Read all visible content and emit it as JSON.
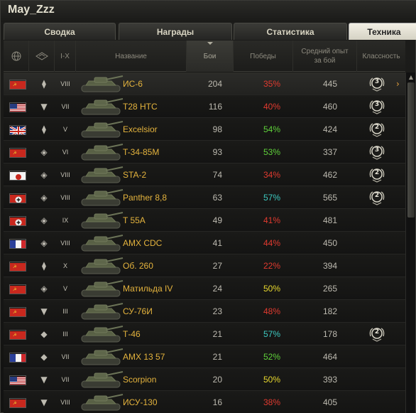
{
  "window": {
    "title": "May_Zzz"
  },
  "tabs": [
    {
      "label": "Сводка"
    },
    {
      "label": "Награды"
    },
    {
      "label": "Статистика"
    },
    {
      "label": "Техника"
    }
  ],
  "columns": {
    "nation_icon": "globe-icon",
    "type_icon": "vehicle-type-icon",
    "tier": "I-X",
    "name": "Название",
    "battles": "Бои",
    "wins": "Победы",
    "avg_xp": "Средний опыт за бой",
    "mastery": "Классность"
  },
  "colors": {
    "accent_gold": "#e4b33d",
    "win_red": "#e03a2f",
    "win_yellow": "#e8d82e",
    "win_green": "#5fd13a",
    "win_teal": "#3dc9c0"
  },
  "vehicles": [
    {
      "nation": "ussr",
      "type": "heavy",
      "tier": "VIII",
      "name": "ИС-6",
      "battles": "204",
      "wins": "35%",
      "win_color": "red",
      "avg_xp": "445",
      "mastery": "3",
      "selected": true
    },
    {
      "nation": "usa",
      "type": "td",
      "tier": "VII",
      "name": "T28 HTC",
      "battles": "116",
      "wins": "40%",
      "win_color": "red",
      "avg_xp": "460",
      "mastery": "3"
    },
    {
      "nation": "uk",
      "type": "heavy",
      "tier": "V",
      "name": "Excelsior",
      "battles": "98",
      "wins": "54%",
      "win_color": "green",
      "avg_xp": "424",
      "mastery": "2"
    },
    {
      "nation": "ussr",
      "type": "medium",
      "tier": "VI",
      "name": "T-34-85M",
      "battles": "93",
      "wins": "53%",
      "win_color": "green",
      "avg_xp": "337",
      "mastery": "3"
    },
    {
      "nation": "japan",
      "type": "medium",
      "tier": "VIII",
      "name": "STA-2",
      "battles": "74",
      "wins": "34%",
      "win_color": "red",
      "avg_xp": "462",
      "mastery": "2"
    },
    {
      "nation": "germany",
      "type": "medium",
      "tier": "VIII",
      "name": "Panther 8,8",
      "battles": "63",
      "wins": "57%",
      "win_color": "teal",
      "avg_xp": "565",
      "mastery": "2"
    },
    {
      "nation": "germany",
      "type": "medium",
      "tier": "IX",
      "name": "T 55A",
      "battles": "49",
      "wins": "41%",
      "win_color": "red",
      "avg_xp": "481",
      "mastery": ""
    },
    {
      "nation": "france",
      "type": "medium",
      "tier": "VIII",
      "name": "AMX CDC",
      "battles": "41",
      "wins": "44%",
      "win_color": "red",
      "avg_xp": "450",
      "mastery": ""
    },
    {
      "nation": "ussr",
      "type": "heavy",
      "tier": "X",
      "name": "Об. 260",
      "battles": "27",
      "wins": "22%",
      "win_color": "red",
      "avg_xp": "394",
      "mastery": ""
    },
    {
      "nation": "ussr",
      "type": "medium",
      "tier": "V",
      "name": "Матильда IV",
      "battles": "24",
      "wins": "50%",
      "win_color": "yellow",
      "avg_xp": "265",
      "mastery": ""
    },
    {
      "nation": "ussr",
      "type": "td",
      "tier": "III",
      "name": "СУ-76И",
      "battles": "23",
      "wins": "48%",
      "win_color": "red",
      "avg_xp": "182",
      "mastery": ""
    },
    {
      "nation": "ussr",
      "type": "light",
      "tier": "III",
      "name": "Т-46",
      "battles": "21",
      "wins": "57%",
      "win_color": "teal",
      "avg_xp": "178",
      "mastery": "2"
    },
    {
      "nation": "france",
      "type": "light",
      "tier": "VII",
      "name": "AMX 13 57",
      "battles": "21",
      "wins": "52%",
      "win_color": "green",
      "avg_xp": "464",
      "mastery": ""
    },
    {
      "nation": "usa",
      "type": "td",
      "tier": "VII",
      "name": "Scorpion",
      "battles": "20",
      "wins": "50%",
      "win_color": "yellow",
      "avg_xp": "393",
      "mastery": ""
    },
    {
      "nation": "ussr",
      "type": "td",
      "tier": "VIII",
      "name": "ИСУ-130",
      "battles": "16",
      "wins": "38%",
      "win_color": "red",
      "avg_xp": "405",
      "mastery": ""
    }
  ]
}
